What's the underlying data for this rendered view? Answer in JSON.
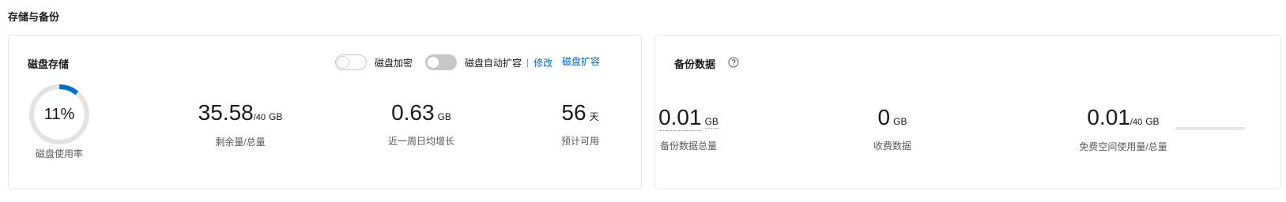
{
  "section": {
    "title": "存储与备份"
  },
  "disk": {
    "title": "磁盘存储",
    "encrypt_label": "磁盘加密",
    "autoexpand_label": "磁盘自动扩容",
    "separator": "|",
    "edit_link": "修改",
    "expand_link": "磁盘扩容",
    "usage": {
      "percent_text": "11%",
      "percent": 11,
      "label": "磁盘使用率",
      "ring_color": "#0070cc"
    },
    "remaining": {
      "value": "35.58",
      "total": "/40",
      "unit": "GB",
      "label": "剩余量/总量"
    },
    "weekly_growth": {
      "value": "0.63",
      "unit": "GB",
      "label": "近一周日均增长"
    },
    "estimate": {
      "value": "56",
      "unit": "天",
      "label": "预计可用"
    }
  },
  "backup": {
    "title": "备份数据",
    "help_icon": "question-circle-icon",
    "total": {
      "value": "0.01",
      "unit": "GB",
      "label": "备份数据总量"
    },
    "paid": {
      "value": "0",
      "unit": "GB",
      "label": "收费数据"
    },
    "free": {
      "value": "0.01",
      "total": "/40",
      "unit": "GB",
      "label": "免费空间使用量/总量",
      "fraction": 0.0
    }
  },
  "colors": {
    "link": "#0064c8",
    "ring_track": "#e3e3e3",
    "accent": "#0070cc"
  }
}
